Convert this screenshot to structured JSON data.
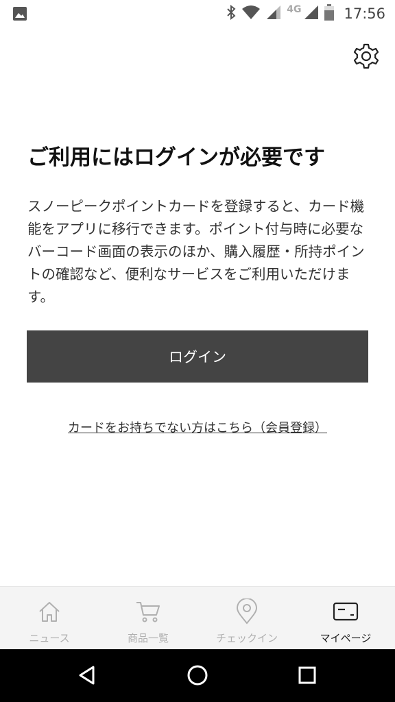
{
  "status_bar": {
    "time": "17:56",
    "network": "4G",
    "icons": [
      "image-icon",
      "bluetooth-icon",
      "wifi-icon",
      "signal-icon",
      "battery-icon"
    ]
  },
  "header": {
    "settings_icon": "gear-icon"
  },
  "main": {
    "title": "ご利用にはログインが必要です",
    "description": "スノーピークポイントカードを登録すると、カード機能をアプリに移行できます。ポイント付与時に必要なバーコード画面の表示のほか、購入履歴・所持ポイントの確認など、便利なサービスをご利用いただけます。",
    "login_button": "ログイン",
    "register_link": "カードをお持ちでない方はこちら（会員登録）"
  },
  "bottom_nav": {
    "items": [
      {
        "label": "ニュース",
        "icon": "home-icon",
        "active": false
      },
      {
        "label": "商品一覧",
        "icon": "cart-icon",
        "active": false
      },
      {
        "label": "チェックイン",
        "icon": "location-pin-icon",
        "active": false
      },
      {
        "label": "マイページ",
        "icon": "card-icon",
        "active": true
      }
    ]
  },
  "system_nav": {
    "icons": [
      "back-icon",
      "home-circle-icon",
      "recents-icon"
    ]
  },
  "colors": {
    "button_bg": "#444444",
    "active_nav": "#222222",
    "inactive_nav": "#b0b0b0",
    "nav_bg": "#f4f4f4"
  }
}
